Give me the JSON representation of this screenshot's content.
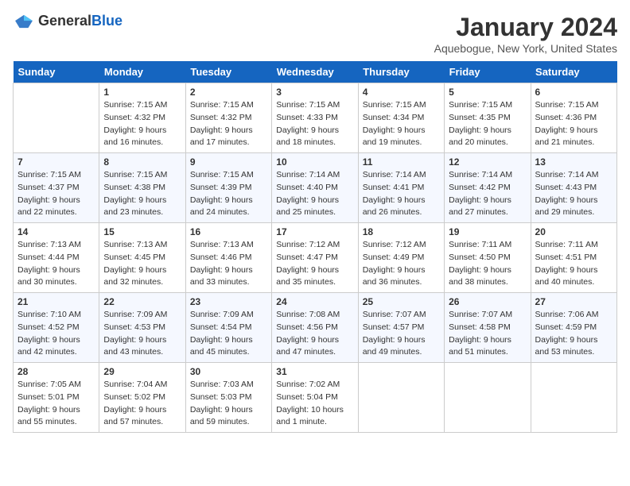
{
  "header": {
    "logo_general": "General",
    "logo_blue": "Blue",
    "title": "January 2024",
    "subtitle": "Aquebogue, New York, United States"
  },
  "days_of_week": [
    "Sunday",
    "Monday",
    "Tuesday",
    "Wednesday",
    "Thursday",
    "Friday",
    "Saturday"
  ],
  "weeks": [
    [
      {
        "day": "",
        "sunrise": "",
        "sunset": "",
        "daylight": ""
      },
      {
        "day": "1",
        "sunrise": "Sunrise: 7:15 AM",
        "sunset": "Sunset: 4:32 PM",
        "daylight": "Daylight: 9 hours and 16 minutes."
      },
      {
        "day": "2",
        "sunrise": "Sunrise: 7:15 AM",
        "sunset": "Sunset: 4:32 PM",
        "daylight": "Daylight: 9 hours and 17 minutes."
      },
      {
        "day": "3",
        "sunrise": "Sunrise: 7:15 AM",
        "sunset": "Sunset: 4:33 PM",
        "daylight": "Daylight: 9 hours and 18 minutes."
      },
      {
        "day": "4",
        "sunrise": "Sunrise: 7:15 AM",
        "sunset": "Sunset: 4:34 PM",
        "daylight": "Daylight: 9 hours and 19 minutes."
      },
      {
        "day": "5",
        "sunrise": "Sunrise: 7:15 AM",
        "sunset": "Sunset: 4:35 PM",
        "daylight": "Daylight: 9 hours and 20 minutes."
      },
      {
        "day": "6",
        "sunrise": "Sunrise: 7:15 AM",
        "sunset": "Sunset: 4:36 PM",
        "daylight": "Daylight: 9 hours and 21 minutes."
      }
    ],
    [
      {
        "day": "7",
        "sunrise": "Sunrise: 7:15 AM",
        "sunset": "Sunset: 4:37 PM",
        "daylight": "Daylight: 9 hours and 22 minutes."
      },
      {
        "day": "8",
        "sunrise": "Sunrise: 7:15 AM",
        "sunset": "Sunset: 4:38 PM",
        "daylight": "Daylight: 9 hours and 23 minutes."
      },
      {
        "day": "9",
        "sunrise": "Sunrise: 7:15 AM",
        "sunset": "Sunset: 4:39 PM",
        "daylight": "Daylight: 9 hours and 24 minutes."
      },
      {
        "day": "10",
        "sunrise": "Sunrise: 7:14 AM",
        "sunset": "Sunset: 4:40 PM",
        "daylight": "Daylight: 9 hours and 25 minutes."
      },
      {
        "day": "11",
        "sunrise": "Sunrise: 7:14 AM",
        "sunset": "Sunset: 4:41 PM",
        "daylight": "Daylight: 9 hours and 26 minutes."
      },
      {
        "day": "12",
        "sunrise": "Sunrise: 7:14 AM",
        "sunset": "Sunset: 4:42 PM",
        "daylight": "Daylight: 9 hours and 27 minutes."
      },
      {
        "day": "13",
        "sunrise": "Sunrise: 7:14 AM",
        "sunset": "Sunset: 4:43 PM",
        "daylight": "Daylight: 9 hours and 29 minutes."
      }
    ],
    [
      {
        "day": "14",
        "sunrise": "Sunrise: 7:13 AM",
        "sunset": "Sunset: 4:44 PM",
        "daylight": "Daylight: 9 hours and 30 minutes."
      },
      {
        "day": "15",
        "sunrise": "Sunrise: 7:13 AM",
        "sunset": "Sunset: 4:45 PM",
        "daylight": "Daylight: 9 hours and 32 minutes."
      },
      {
        "day": "16",
        "sunrise": "Sunrise: 7:13 AM",
        "sunset": "Sunset: 4:46 PM",
        "daylight": "Daylight: 9 hours and 33 minutes."
      },
      {
        "day": "17",
        "sunrise": "Sunrise: 7:12 AM",
        "sunset": "Sunset: 4:47 PM",
        "daylight": "Daylight: 9 hours and 35 minutes."
      },
      {
        "day": "18",
        "sunrise": "Sunrise: 7:12 AM",
        "sunset": "Sunset: 4:49 PM",
        "daylight": "Daylight: 9 hours and 36 minutes."
      },
      {
        "day": "19",
        "sunrise": "Sunrise: 7:11 AM",
        "sunset": "Sunset: 4:50 PM",
        "daylight": "Daylight: 9 hours and 38 minutes."
      },
      {
        "day": "20",
        "sunrise": "Sunrise: 7:11 AM",
        "sunset": "Sunset: 4:51 PM",
        "daylight": "Daylight: 9 hours and 40 minutes."
      }
    ],
    [
      {
        "day": "21",
        "sunrise": "Sunrise: 7:10 AM",
        "sunset": "Sunset: 4:52 PM",
        "daylight": "Daylight: 9 hours and 42 minutes."
      },
      {
        "day": "22",
        "sunrise": "Sunrise: 7:09 AM",
        "sunset": "Sunset: 4:53 PM",
        "daylight": "Daylight: 9 hours and 43 minutes."
      },
      {
        "day": "23",
        "sunrise": "Sunrise: 7:09 AM",
        "sunset": "Sunset: 4:54 PM",
        "daylight": "Daylight: 9 hours and 45 minutes."
      },
      {
        "day": "24",
        "sunrise": "Sunrise: 7:08 AM",
        "sunset": "Sunset: 4:56 PM",
        "daylight": "Daylight: 9 hours and 47 minutes."
      },
      {
        "day": "25",
        "sunrise": "Sunrise: 7:07 AM",
        "sunset": "Sunset: 4:57 PM",
        "daylight": "Daylight: 9 hours and 49 minutes."
      },
      {
        "day": "26",
        "sunrise": "Sunrise: 7:07 AM",
        "sunset": "Sunset: 4:58 PM",
        "daylight": "Daylight: 9 hours and 51 minutes."
      },
      {
        "day": "27",
        "sunrise": "Sunrise: 7:06 AM",
        "sunset": "Sunset: 4:59 PM",
        "daylight": "Daylight: 9 hours and 53 minutes."
      }
    ],
    [
      {
        "day": "28",
        "sunrise": "Sunrise: 7:05 AM",
        "sunset": "Sunset: 5:01 PM",
        "daylight": "Daylight: 9 hours and 55 minutes."
      },
      {
        "day": "29",
        "sunrise": "Sunrise: 7:04 AM",
        "sunset": "Sunset: 5:02 PM",
        "daylight": "Daylight: 9 hours and 57 minutes."
      },
      {
        "day": "30",
        "sunrise": "Sunrise: 7:03 AM",
        "sunset": "Sunset: 5:03 PM",
        "daylight": "Daylight: 9 hours and 59 minutes."
      },
      {
        "day": "31",
        "sunrise": "Sunrise: 7:02 AM",
        "sunset": "Sunset: 5:04 PM",
        "daylight": "Daylight: 10 hours and 1 minute."
      },
      {
        "day": "",
        "sunrise": "",
        "sunset": "",
        "daylight": ""
      },
      {
        "day": "",
        "sunrise": "",
        "sunset": "",
        "daylight": ""
      },
      {
        "day": "",
        "sunrise": "",
        "sunset": "",
        "daylight": ""
      }
    ]
  ]
}
